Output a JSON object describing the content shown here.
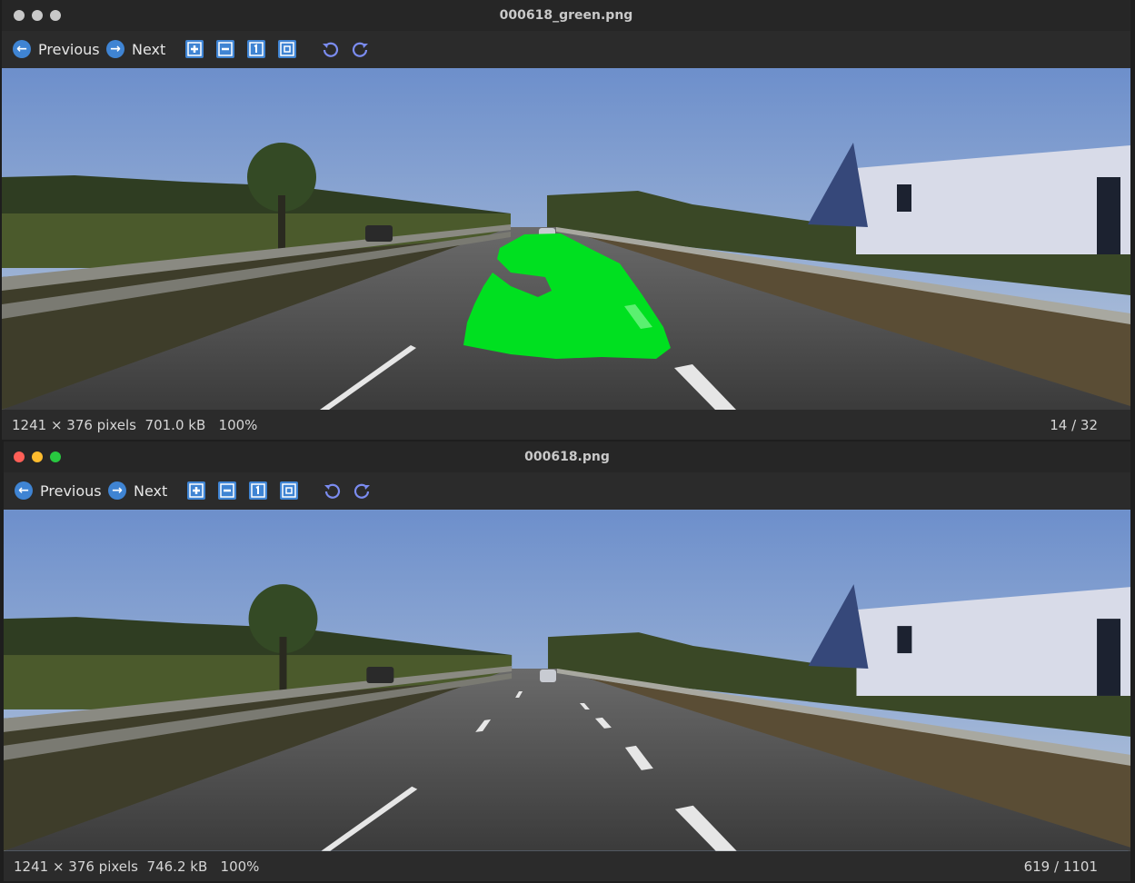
{
  "windows": [
    {
      "title": "000618_green.png",
      "nav": {
        "previous": "Previous",
        "next": "Next"
      },
      "status": {
        "dims": "1241 × 376 pixels",
        "size": "701.0 kB",
        "zoom": "100%",
        "counter": "14 / 32"
      },
      "overlay": true
    },
    {
      "title": "000618.png",
      "nav": {
        "previous": "Previous",
        "next": "Next"
      },
      "status": {
        "dims": "1241 × 376 pixels",
        "size": "746.2 kB",
        "zoom": "100%",
        "counter": "619 / 1101"
      },
      "overlay": false
    }
  ],
  "icons": {
    "previous": "arrow-left-icon",
    "next": "arrow-right-icon",
    "zoom_in": "zoom-in-icon",
    "zoom_out": "zoom-out-icon",
    "actual_size": "actual-size-icon",
    "fit": "fit-window-icon",
    "rotate_left": "rotate-left-icon",
    "rotate_right": "rotate-right-icon"
  },
  "colors": {
    "accent": "#3f84d3",
    "overlay": "#00e020",
    "close": "#ff5f57",
    "minimize": "#febc2e",
    "zoom": "#28c840"
  }
}
